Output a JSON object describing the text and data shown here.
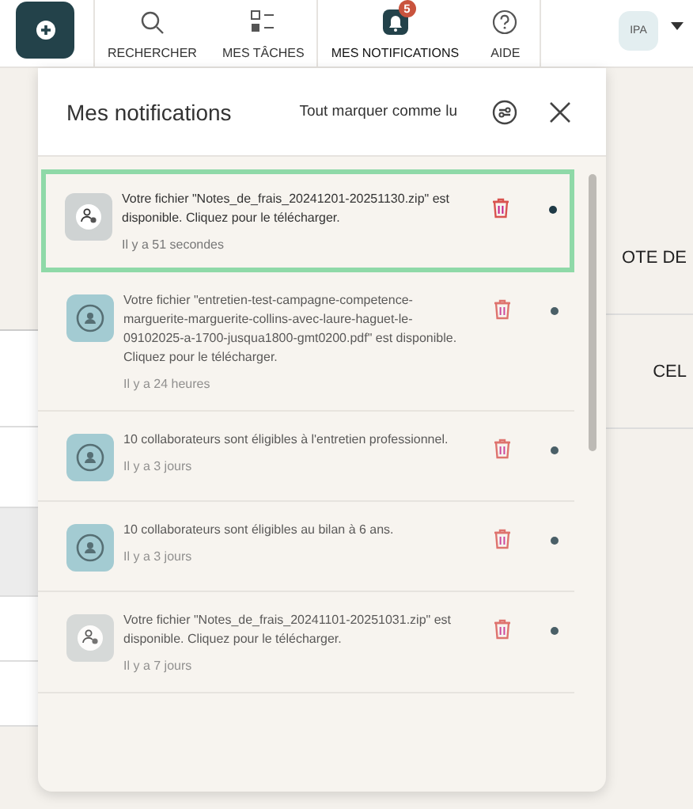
{
  "topbar": {
    "nav": [
      {
        "label": "RECHERCHER",
        "kind": "search",
        "selected": false
      },
      {
        "label": "MES TÂCHES",
        "kind": "tasks",
        "selected": false
      },
      {
        "label": "MES NOTIFICATIONS",
        "kind": "bell",
        "badge": "5",
        "selected": true
      },
      {
        "label": "AIDE",
        "kind": "help",
        "selected": false
      }
    ],
    "avatar": "IPA"
  },
  "background": {
    "cells": [
      "OTE DE",
      "CEL"
    ]
  },
  "panel": {
    "title": "Mes notifications",
    "mark_all": "Tout marquer comme lu",
    "items": [
      {
        "kind": "file",
        "text": "Votre fichier \"Notes_de_frais_20241201-20251130.zip\" est disponible. Cliquez pour le télécharger.",
        "time": "Il y a 51 secondes",
        "selected": true,
        "unread": true
      },
      {
        "kind": "person",
        "text": "Votre fichier \"entretien-test-campagne-competence-marguerite-marguerite-collins-avec-laure-haguet-le-09102025-a-1700-jusqua1800-gmt0200.pdf\" est disponible. Cliquez pour le télécharger.",
        "time": "Il y a 24 heures",
        "selected": false,
        "unread": true
      },
      {
        "kind": "person",
        "text": "10 collaborateurs sont éligibles à l'entretien professionnel.",
        "time": "Il y a 3 jours",
        "selected": false,
        "unread": true
      },
      {
        "kind": "person",
        "text": "10 collaborateurs sont éligibles au bilan à 6 ans.",
        "time": "Il y a 3 jours",
        "selected": false,
        "unread": true
      },
      {
        "kind": "file",
        "text": "Votre fichier \"Notes_de_frais_20241101-20251031.zip\" est disponible. Cliquez pour le télécharger.",
        "time": "Il y a 7 jours",
        "selected": false,
        "unread": true
      }
    ]
  }
}
